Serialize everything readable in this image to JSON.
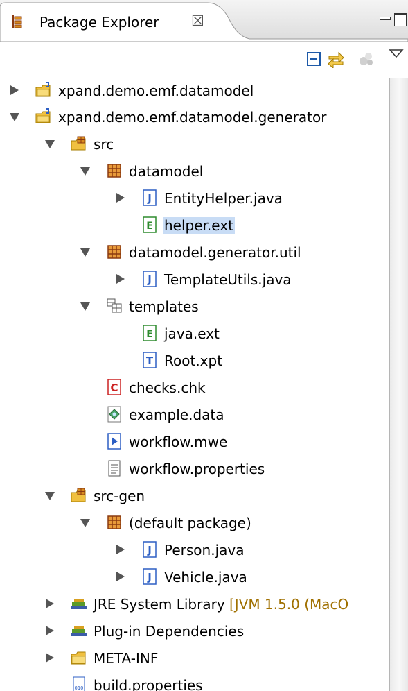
{
  "view": {
    "title": "Package Explorer",
    "close_glyph": "☒"
  },
  "toolbar": {
    "buttons": [
      "collapse-all-icon",
      "link-with-editor-icon",
      "filters-icon",
      "view-menu-icon"
    ]
  },
  "tree": [
    {
      "label": "xpand.demo.emf.datamodel",
      "icon": "project-icon",
      "expanded": false
    },
    {
      "label": "xpand.demo.emf.datamodel.generator",
      "icon": "project-icon",
      "expanded": true
    },
    {
      "label": "src",
      "icon": "source-folder-icon",
      "expanded": true
    },
    {
      "label": "datamodel",
      "icon": "package-icon",
      "expanded": true
    },
    {
      "label": "EntityHelper.java",
      "icon": "java-file-icon",
      "expanded": false
    },
    {
      "label": "helper.ext",
      "icon": "ext-file-icon",
      "selected": true
    },
    {
      "label": "datamodel.generator.util",
      "icon": "package-icon",
      "expanded": true
    },
    {
      "label": "TemplateUtils.java",
      "icon": "java-file-icon",
      "expanded": false
    },
    {
      "label": "templates",
      "icon": "folder-package-icon",
      "expanded": true
    },
    {
      "label": "java.ext",
      "icon": "ext-file-icon"
    },
    {
      "label": "Root.xpt",
      "icon": "template-file-icon"
    },
    {
      "label": "checks.chk",
      "icon": "check-file-icon"
    },
    {
      "label": "example.data",
      "icon": "data-file-icon"
    },
    {
      "label": "workflow.mwe",
      "icon": "workflow-file-icon"
    },
    {
      "label": "workflow.properties",
      "icon": "properties-file-icon"
    },
    {
      "label": "src-gen",
      "icon": "source-folder-icon",
      "expanded": true
    },
    {
      "label": "(default package)",
      "icon": "package-icon",
      "expanded": true
    },
    {
      "label": "Person.java",
      "icon": "java-file-icon",
      "expanded": false
    },
    {
      "label": "Vehicle.java",
      "icon": "java-file-icon",
      "expanded": false
    },
    {
      "label": "JRE System Library",
      "decoration": "[JVM 1.5.0 (MacO",
      "icon": "library-icon",
      "expanded": false
    },
    {
      "label": "Plug-in Dependencies",
      "icon": "library-icon",
      "expanded": false
    },
    {
      "label": "META-INF",
      "icon": "folder-icon",
      "expanded": false
    },
    {
      "label": "build.properties",
      "icon": "binary-properties-icon"
    }
  ],
  "colors": {
    "selection": "#c8dcf5",
    "decoration": "#a07000",
    "java_blue": "#2d5fc4",
    "package_brown": "#8a3a10",
    "folder_yellow": "#f0c040"
  }
}
